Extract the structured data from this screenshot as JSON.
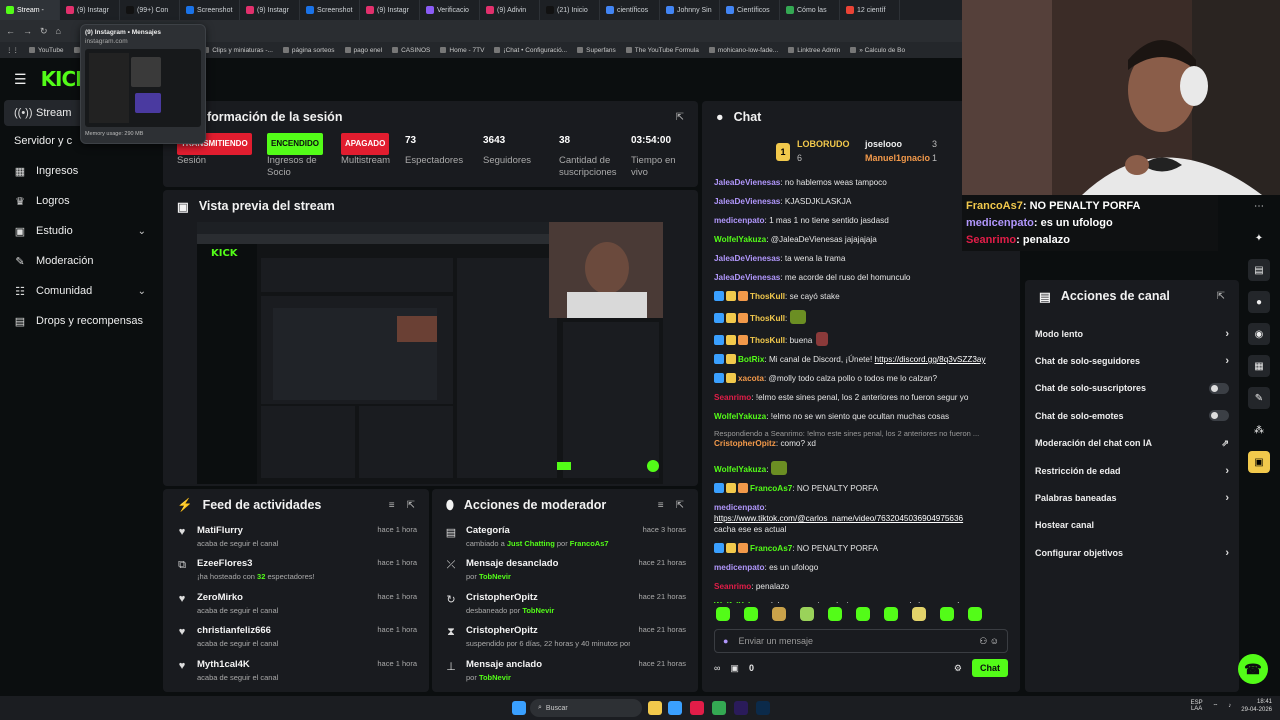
{
  "browser": {
    "tabs": [
      {
        "label": "Stream - ",
        "color": "#53fc18",
        "active": true
      },
      {
        "label": "(9) Instagr",
        "color": "#e1306c"
      },
      {
        "label": "(99+) Con",
        "color": "#111111"
      },
      {
        "label": "Screenshot",
        "color": "#1a73e8"
      },
      {
        "label": "(9) Instagr",
        "color": "#e1306c"
      },
      {
        "label": "Screenshot",
        "color": "#1a73e8"
      },
      {
        "label": "(9) Instagr",
        "color": "#e1306c"
      },
      {
        "label": "Verificacio",
        "color": "#8b5cf6"
      },
      {
        "label": "(9) Adivin",
        "color": "#e1306c"
      },
      {
        "label": "(21) Inicio",
        "color": "#111111"
      },
      {
        "label": "científicos",
        "color": "#4285f4"
      },
      {
        "label": "Johnny Sin",
        "color": "#4285f4"
      },
      {
        "label": "Científicos",
        "color": "#4285f4"
      },
      {
        "label": "Cómo las",
        "color": "#34a853"
      },
      {
        "label": "12 científ",
        "color": "#ea4335"
      }
    ],
    "bookmarks": [
      "YouTube",
      "Dashboard | Kick",
      "Stripe Express",
      "Clips y miniaturas -...",
      "página sorteos",
      "pago enel",
      "CASINOS",
      "Home - 7TV",
      "¡Chat • Configuració...",
      "Superfans",
      "The YouTube Formula",
      "mohicano-low-fade...",
      "Linktree Admin",
      "» Calculo de Bo"
    ],
    "popup": {
      "title": "(9) Instagram • Mensajes",
      "url": "instagram.com",
      "memory": "Memory usage: 290 MB"
    }
  },
  "sidebar": {
    "items": [
      {
        "label": "Stream",
        "icon": "broadcast-icon",
        "glyph": "((•))",
        "active": true
      },
      {
        "label": "Servidor y c",
        "icon": "",
        "glyph": ""
      },
      {
        "label": "Ingresos",
        "icon": "revenue-icon",
        "glyph": "▦"
      },
      {
        "label": "Logros",
        "icon": "trophy-icon",
        "glyph": "♛"
      },
      {
        "label": "Estudio",
        "icon": "studio-icon",
        "glyph": "▣",
        "expand": "⌄"
      },
      {
        "label": "Moderación",
        "icon": "wrench-icon",
        "glyph": "✎"
      },
      {
        "label": "Comunidad",
        "icon": "community-icon",
        "glyph": "☷",
        "expand": "⌄"
      },
      {
        "label": "Drops y recompensas",
        "icon": "gift-icon",
        "glyph": "▤"
      }
    ]
  },
  "session": {
    "title": "formación de la sesión",
    "stats": [
      {
        "value": "TRANSMITIENDO",
        "label": "Sesión",
        "badge_color": "#e11d2f",
        "text_color": "#ffffff"
      },
      {
        "value": "ENCENDIDO",
        "label": "Ingresos de Socio",
        "badge_color": "#53fc18",
        "text_color": "#0b0e0f"
      },
      {
        "value": "APAGADO",
        "label": "Multistream",
        "badge_color": "#e11d2f",
        "text_color": "#ffffff"
      },
      {
        "value": "73",
        "label": "Espectadores"
      },
      {
        "value": "3643",
        "label": "Seguidores"
      },
      {
        "value": "38",
        "label": "Cantidad de suscripciones"
      },
      {
        "value": "03:54:00",
        "label": "Tiempo en vivo"
      }
    ]
  },
  "preview": {
    "title": "Vista previa del stream"
  },
  "activity_feed": {
    "title": "Feed de actividades",
    "items": [
      {
        "name": "MatiFlurry",
        "sub": "acaba de seguir el canal",
        "time": "hace 1 hora",
        "icon": "heart-icon",
        "glyph": "♥"
      },
      {
        "name": "EzeeFlores3",
        "sub_pre": "¡ha hosteado con ",
        "sub_hl": "32",
        "sub_post": " espectadores!",
        "time": "hace 1 hora",
        "icon": "host-icon",
        "glyph": "⧉"
      },
      {
        "name": "ZeroMirko",
        "sub": "acaba de seguir el canal",
        "time": "hace 1 hora",
        "icon": "heart-icon",
        "glyph": "♥"
      },
      {
        "name": "christianfeliz666",
        "sub": "acaba de seguir el canal",
        "time": "hace 1 hora",
        "icon": "heart-icon",
        "glyph": "♥"
      },
      {
        "name": "Myth1cal4K",
        "sub": "acaba de seguir el canal",
        "time": "hace 1 hora",
        "icon": "heart-icon",
        "glyph": "♥"
      }
    ]
  },
  "mod_actions": {
    "title": "Acciones de moderador",
    "items": [
      {
        "name": "Categoría",
        "sub_pre": "cambiado a ",
        "sub_hl": "Just Chatting",
        "sub_mid": " por ",
        "sub_hl2": "FrancoAs7",
        "time": "hace 3 horas",
        "icon": "category-icon",
        "glyph": "▤"
      },
      {
        "name": "Mensaje desanclado",
        "sub_pre": "por ",
        "sub_hl": "TobNevir",
        "time": "hace 21 horas",
        "icon": "unpin-icon",
        "glyph": "⤫"
      },
      {
        "name": "CristopherOpitz",
        "sub_pre": "desbaneado por ",
        "sub_hl": "TobNevir",
        "time": "hace 21 horas",
        "icon": "unban-icon",
        "glyph": "↻"
      },
      {
        "name": "CristopherOpitz",
        "sub_pre": "suspendido por 6 días, 22 horas y 40 minutos por ",
        "sub_hl": "TobNevir",
        "time": "hace 21 horas",
        "icon": "hourglass-icon",
        "glyph": "⧗"
      },
      {
        "name": "Mensaje anclado",
        "sub_pre": "por ",
        "sub_hl": "TobNevir",
        "time": "hace 21 horas",
        "icon": "pin-icon",
        "glyph": "⊥"
      }
    ]
  },
  "chat": {
    "title": "Chat",
    "leaderboard": {
      "first": "LOBORUDO",
      "first_count": "6",
      "second": "joselooo",
      "second_count": "3",
      "third": "Manuel1gnacio",
      "third_count": "1"
    },
    "messages": [
      {
        "user": "JaleaDeVienesas",
        "color": "#b197fc",
        "text": "no hablemos weas tampoco"
      },
      {
        "user": "JaleaDeVienesas",
        "color": "#b197fc",
        "text": "KJASDJKLASKJA"
      },
      {
        "user": "medicenpato",
        "color": "#b197fc",
        "text": "1 mas 1 no tiene sentido jasdasd"
      },
      {
        "user": "WolfelYakuza",
        "color": "#53fc18",
        "text": "@JaleaDeVienesas jajajajaja"
      },
      {
        "user": "JaleaDeVienesas",
        "color": "#b197fc",
        "text": "ta wena la trama"
      },
      {
        "user": "JaleaDeVienesas",
        "color": "#b197fc",
        "text": "me acorde del ruso del homunculo"
      },
      {
        "user": "ThosKull",
        "color": "#f2c94c",
        "text": "se cayó stake",
        "badges": 3
      },
      {
        "user": "ThosKull",
        "color": "#f2c94c",
        "text": "",
        "badges": 3,
        "emote": true
      },
      {
        "user": "ThosKull",
        "color": "#f2c94c",
        "text": "buena",
        "badges": 3,
        "emote_after": true
      },
      {
        "user": "BotRix",
        "color": "#53fc18",
        "text": "Mi canal de Discord, ¡Únete! ",
        "link": "https://discord.gg/8q3vSZZ3ay",
        "badges": 2
      },
      {
        "user": "xacota",
        "color": "#f2994a",
        "text": "@molly todo calza pollo o todos me lo calzan?",
        "badges": 2
      },
      {
        "user": "Seanrimo",
        "color": "#e11d48",
        "text": "!elmo este sines penal, los 2 anteriores no fueron segur yo"
      },
      {
        "user": "WolfelYakuza",
        "color": "#53fc18",
        "text": "!elmo no se wn siento que ocultan muchas cosas"
      },
      {
        "reply": "Respondiendo a Seanrimo: !elmo este sines penal, los 2 anteriores no fueron ...",
        "user": "CristopherOpitz",
        "color": "#f2994a",
        "text": "como? xd"
      },
      {
        "user": "WolfelYakuza",
        "color": "#53fc18",
        "text": "",
        "emote": true
      },
      {
        "user": "FrancoAs7",
        "color": "#53fc18",
        "text": "NO PENALTY PORFA",
        "badges": 3
      },
      {
        "user": "medicenpato",
        "color": "#b197fc",
        "text": "",
        "link": "https://www.tiktok.com/@carlos_name/video/7632045036904975636",
        "after": "cacha ese es actual"
      },
      {
        "user": "FrancoAs7",
        "color": "#53fc18",
        "text": "NO PENALTY PORFA",
        "badges": 3
      },
      {
        "user": "medicenpato",
        "color": "#b197fc",
        "text": "es un ufologo"
      },
      {
        "user": "Seanrimo",
        "color": "#e11d48",
        "text": "penalazo"
      },
      {
        "user": "WolfelYakuza",
        "color": "#53fc18",
        "text": "!elmo eso quiere decir que van sacando las cosas de a poco"
      }
    ],
    "input_placeholder": "Enviar un mensaje",
    "points": "0",
    "send_label": "Chat"
  },
  "overlay": {
    "lines": [
      {
        "user": "FrancoAs7",
        "color": "#f2c94c",
        "text": "NO PENALTY PORFA"
      },
      {
        "user": "medicenpato",
        "color": "#b197fc",
        "text": "es un ufologo"
      },
      {
        "user": "Seanrimo",
        "color": "#e11d48",
        "text": "penalazo"
      }
    ]
  },
  "channel_actions": {
    "title": "Acciones de canal",
    "items": [
      {
        "label": "Modo lento",
        "control": "chevron"
      },
      {
        "label": "Chat de solo-seguidores",
        "control": "chevron"
      },
      {
        "label": "Chat de solo-suscriptores",
        "control": "toggle"
      },
      {
        "label": "Chat de solo-emotes",
        "control": "toggle"
      },
      {
        "label": "Moderación del chat con IA",
        "control": "external"
      },
      {
        "label": "Restricción de edad",
        "control": "chevron"
      },
      {
        "label": "Palabras baneadas",
        "control": "chevron"
      },
      {
        "label": "Hostear canal",
        "control": "none"
      },
      {
        "label": "Configurar objetivos",
        "control": "chevron"
      }
    ]
  },
  "taskbar": {
    "search_placeholder": "Buscar",
    "lang": "ESP\nLAA",
    "time": "18:41",
    "date": "29-04-2026"
  }
}
